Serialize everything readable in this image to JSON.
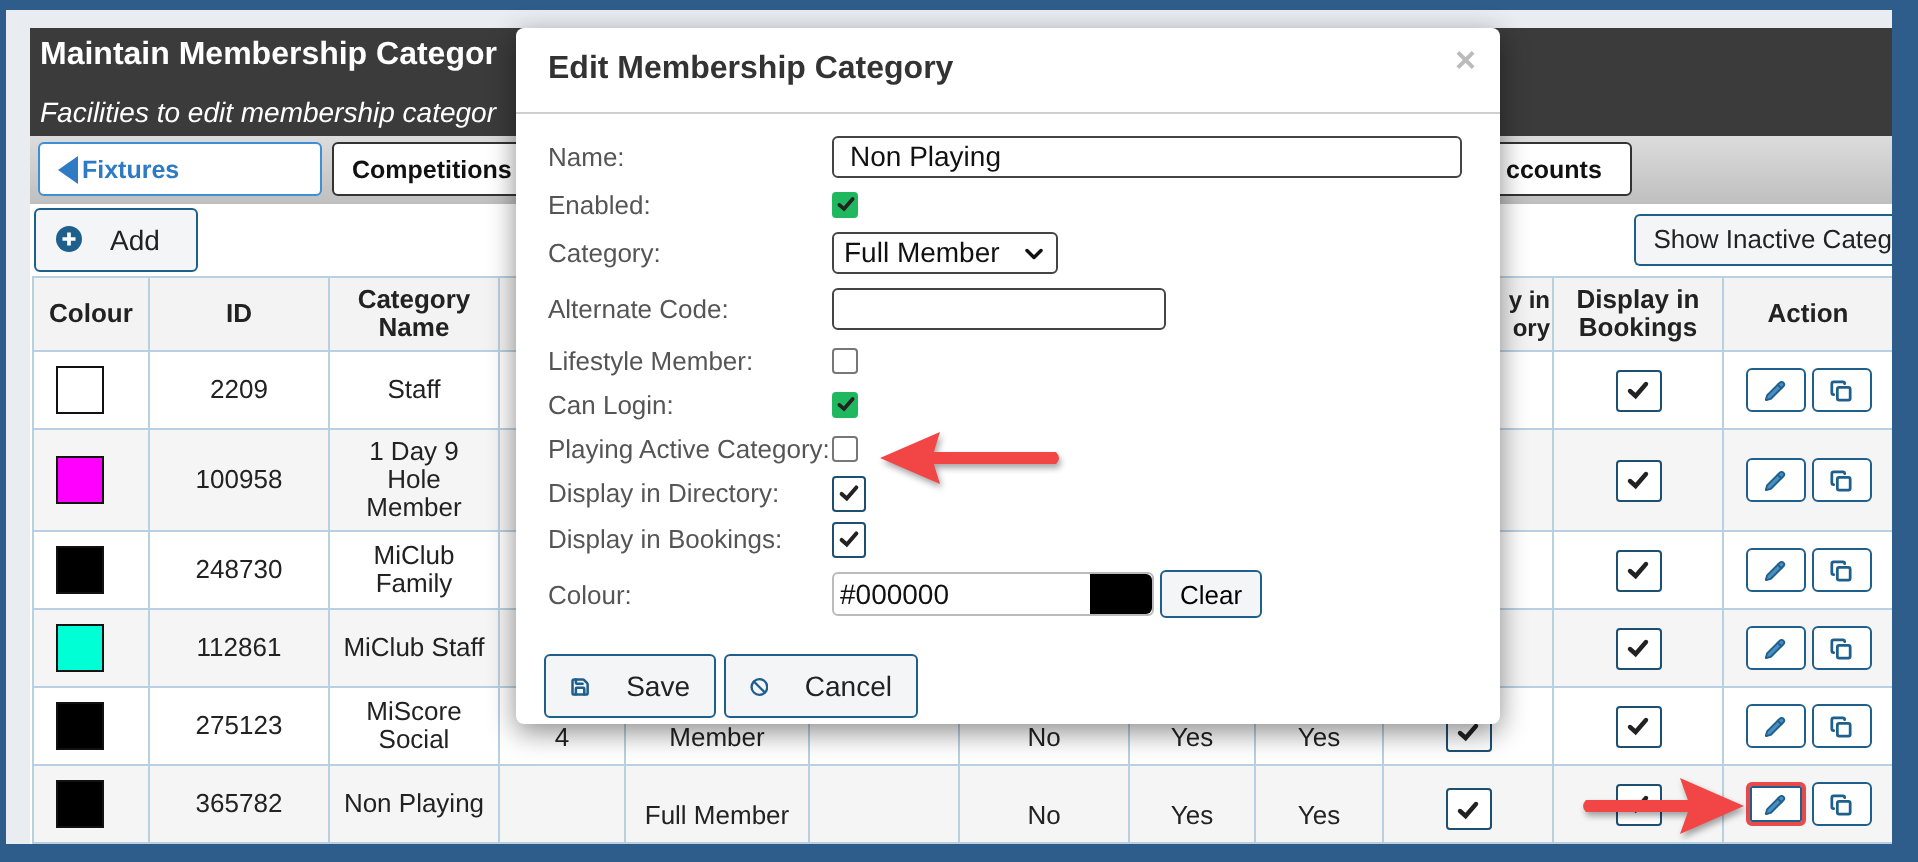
{
  "header": {
    "title": "Maintain Membership Categor",
    "subtitle": "Facilities to edit membership categor"
  },
  "nav_tabs": [
    {
      "label": "Fixtures",
      "kind": "back",
      "selected": true
    },
    {
      "label": "Competitions",
      "kind": "plain",
      "selected": false
    },
    {
      "label": "ccounts",
      "kind": "plain",
      "selected": false
    }
  ],
  "add_button": "Add",
  "show_inactive_button": "Show Inactive Categ",
  "table": {
    "columns": [
      "Colour",
      "ID",
      "Category Name",
      "y in ory",
      "Display in Bookings",
      "Action"
    ],
    "rows": [
      {
        "color": "#ffffff",
        "id": "2209",
        "name": "Staff",
        "in_bookings": true,
        "edit_highlighted": false
      },
      {
        "color": "#ff00ff",
        "id": "100958",
        "name": "1 Day 9 Hole Member",
        "in_bookings": true,
        "edit_highlighted": false
      },
      {
        "color": "#000000",
        "id": "248730",
        "name": "MiClub Family",
        "in_bookings": true,
        "edit_highlighted": false
      },
      {
        "color": "#00ffd5",
        "id": "112861",
        "name": "MiClub Staff",
        "in_bookings": true,
        "edit_highlighted": false
      },
      {
        "color": "#000000",
        "id": "275123",
        "name": "MiScore Social",
        "column_4": "4",
        "column_5": "Member",
        "column_7": "No",
        "column_8": "Yes",
        "column_9": "Yes",
        "in_directory": true,
        "in_bookings": true,
        "edit_highlighted": false
      },
      {
        "color": "#000000",
        "id": "365782",
        "name": "Non Playing",
        "column_5": "Full Member",
        "column_7": "No",
        "column_8": "Yes",
        "column_9": "Yes",
        "in_directory": true,
        "in_bookings": true,
        "edit_highlighted": true
      }
    ]
  },
  "dialog": {
    "title": "Edit Membership Category",
    "close": "×",
    "fields": [
      {
        "label": "Name:",
        "kind": "text",
        "value": "Non Playing"
      },
      {
        "label": "Enabled:",
        "kind": "checkbox",
        "checked": true
      },
      {
        "label": "Category:",
        "kind": "select",
        "value": "Full Member"
      },
      {
        "label": "Alternate Code:",
        "kind": "short"
      },
      {
        "label": "Lifestyle Member:",
        "kind": "checkbox",
        "checked": false
      },
      {
        "label": "Can Login:",
        "kind": "checkbox",
        "checked": true
      },
      {
        "label": "Playing Active Category:",
        "kind": "checkbox",
        "checked": false
      },
      {
        "label": "Display in Directory:",
        "kind": "tickbox",
        "checked": true
      },
      {
        "label": "Display in Bookings:",
        "kind": "tickbox",
        "checked": true
      },
      {
        "label": "Colour:",
        "kind": "colour",
        "value": "#000000",
        "color": "#000000",
        "button": "Clear"
      }
    ],
    "buttons": [
      {
        "label": "Save",
        "kind": "save"
      },
      {
        "label": "Cancel",
        "kind": "cancel"
      }
    ]
  }
}
